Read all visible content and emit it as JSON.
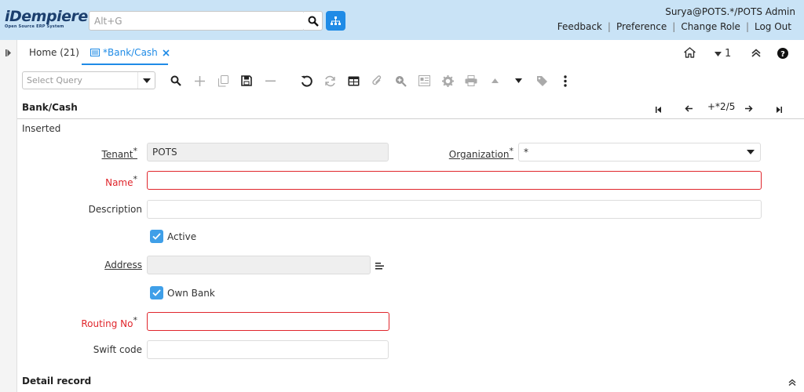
{
  "header": {
    "logo_main": "iDempiere",
    "logo_sub": "Open Source ERP System",
    "search_placeholder": "Alt+G",
    "user": "Surya@POTS.*/POTS Admin",
    "links": [
      "Feedback",
      "Preference",
      "Change Role",
      "Log Out"
    ]
  },
  "tabs": {
    "home": "Home (21)",
    "active": "*Bank/Cash"
  },
  "tabbar_right": {
    "count": "1"
  },
  "toolbar": {
    "query_placeholder": "Select Query"
  },
  "window": {
    "title": "Bank/Cash",
    "record_nav": "+*2/5",
    "status": "Inserted"
  },
  "form": {
    "tenant_label": "Tenant",
    "tenant_value": "POTS",
    "organization_label": "Organization",
    "organization_value": "*",
    "name_label": "Name",
    "name_value": "",
    "description_label": "Description",
    "description_value": "",
    "active_label": "Active",
    "address_label": "Address",
    "address_value": "",
    "own_bank_label": "Own Bank",
    "routing_label": "Routing No",
    "routing_value": "",
    "swift_label": "Swift code",
    "swift_value": "",
    "required_mark": "*"
  },
  "detail": {
    "title": "Detail record"
  },
  "colors": {
    "accent": "#1f8be6",
    "header_bg": "#c9e3f6",
    "required": "#e0262c"
  }
}
